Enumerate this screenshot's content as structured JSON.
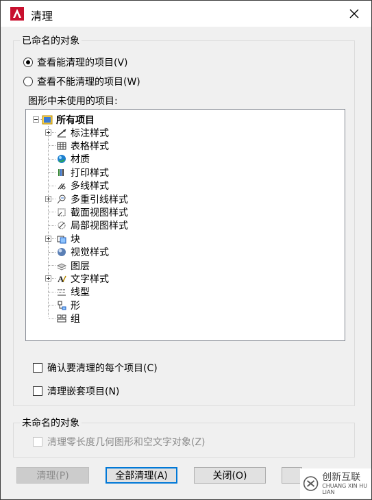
{
  "window": {
    "title": "清理"
  },
  "named_group": {
    "legend": "已命名的对象",
    "radio_view_purgeable": "查看能清理的项目(V)",
    "radio_view_unpurgeable": "查看不能清理的项目(W)",
    "tree_label": "图形中未使用的项目:",
    "tree": {
      "root": "所有项目",
      "items": [
        {
          "label": "标注样式",
          "expandable": true,
          "icon": "dimension-style-icon"
        },
        {
          "label": "表格样式",
          "expandable": false,
          "icon": "table-style-icon"
        },
        {
          "label": "材质",
          "expandable": false,
          "icon": "material-icon"
        },
        {
          "label": "打印样式",
          "expandable": false,
          "icon": "plot-style-icon"
        },
        {
          "label": "多线样式",
          "expandable": false,
          "icon": "multiline-style-icon"
        },
        {
          "label": "多重引线样式",
          "expandable": true,
          "icon": "multileader-style-icon"
        },
        {
          "label": "截面视图样式",
          "expandable": false,
          "icon": "section-view-style-icon"
        },
        {
          "label": "局部视图样式",
          "expandable": false,
          "icon": "detail-view-style-icon"
        },
        {
          "label": "块",
          "expandable": true,
          "icon": "block-icon"
        },
        {
          "label": "视觉样式",
          "expandable": false,
          "icon": "visual-style-icon"
        },
        {
          "label": "图层",
          "expandable": false,
          "icon": "layer-icon"
        },
        {
          "label": "文字样式",
          "expandable": true,
          "icon": "text-style-icon"
        },
        {
          "label": "线型",
          "expandable": false,
          "icon": "linetype-icon"
        },
        {
          "label": "形",
          "expandable": false,
          "icon": "shape-icon"
        },
        {
          "label": "组",
          "expandable": false,
          "icon": "group-icon"
        }
      ]
    },
    "confirm_each": "确认要清理的每个项目(C)",
    "purge_nested": "清理嵌套项目(N)"
  },
  "unnamed_group": {
    "legend": "未命名的对象",
    "purge_zero_length": "清理零长度几何图形和空文字对象(Z)"
  },
  "buttons": {
    "purge": "清理(P)",
    "purge_all": "全部清理(A)",
    "close": "关闭(O)"
  },
  "watermark": {
    "line1": "创新互联",
    "line2": "CHUANG XIN HU LIAN"
  },
  "colors": {
    "accent": "#0078d7",
    "app_icon": "#c8102e"
  }
}
